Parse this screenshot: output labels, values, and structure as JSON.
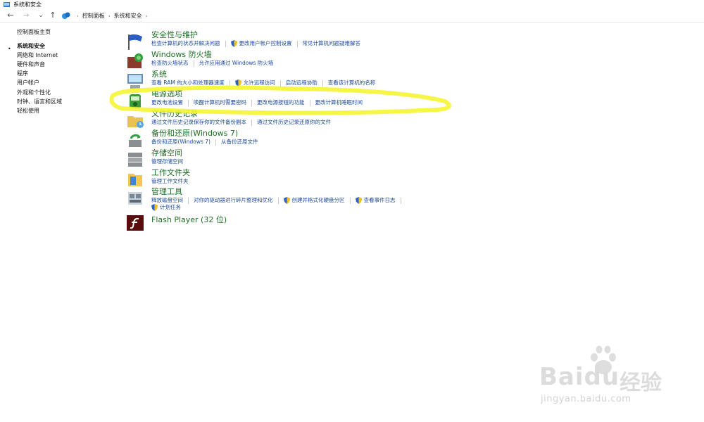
{
  "window": {
    "title": "系统和安全"
  },
  "nav": {
    "back_icon": "←",
    "forward_icon": "→",
    "dropdown_icon": "⌄",
    "up_icon": "↑",
    "breadcrumbs": [
      "控制面板",
      "系统和安全"
    ],
    "breadcrumb_sep": "›",
    "breadcrumb_dropdown": "›"
  },
  "sidebar": {
    "bullet": "•",
    "items": [
      {
        "label": "控制面板主页"
      },
      {
        "label": "系统和安全"
      },
      {
        "label": "网络和 Internet"
      },
      {
        "label": "硬件和声音"
      },
      {
        "label": "程序"
      },
      {
        "label": "用户帐户"
      },
      {
        "label": "外观和个性化"
      },
      {
        "label": "时钟、语言和区域"
      },
      {
        "label": "轻松使用"
      }
    ]
  },
  "categories": [
    {
      "icon": "flag-icon",
      "title": "安全性与维护",
      "links": [
        {
          "label": "检查计算机的状态并解决问题"
        },
        {
          "label": "更改用户帐户控制设置",
          "shield": true
        },
        {
          "label": "常见计算机问题疑难解答"
        }
      ]
    },
    {
      "icon": "firewall-icon",
      "title": "Windows 防火墙",
      "links": [
        {
          "label": "检查防火墙状态"
        },
        {
          "label": "允许应用通过 Windows 防火墙"
        }
      ]
    },
    {
      "icon": "computer-icon",
      "title": "系统",
      "links": [
        {
          "label": "查看 RAM 的大小和处理器速度"
        },
        {
          "label": "允许远程访问",
          "shield": true
        },
        {
          "label": "启动远程协助"
        },
        {
          "label": "查看该计算机的名称"
        }
      ]
    },
    {
      "icon": "power-icon",
      "title": "电源选项",
      "links": [
        {
          "label": "更改电池设置"
        },
        {
          "label": "唤醒计算机时需要密码"
        },
        {
          "label": "更改电源按钮的功能"
        },
        {
          "label": "更改计算机睡眠时间"
        }
      ]
    },
    {
      "icon": "file-history-icon",
      "title": "文件历史记录",
      "links": [
        {
          "label": "通过文件历史记录保存你的文件备份副本"
        },
        {
          "label": "通过文件历史记录还原你的文件"
        }
      ]
    },
    {
      "icon": "backup-icon",
      "title": "备份和还原(Windows 7)",
      "links": [
        {
          "label": "备份和还原(Windows 7)"
        },
        {
          "label": "从备份还原文件"
        }
      ]
    },
    {
      "icon": "storage-icon",
      "title": "存储空间",
      "links": [
        {
          "label": "管理存储空间"
        }
      ]
    },
    {
      "icon": "work-folders-icon",
      "title": "工作文件夹",
      "links": [
        {
          "label": "管理工作文件夹"
        }
      ]
    },
    {
      "icon": "admin-tools-icon",
      "title": "管理工具",
      "links": [
        {
          "label": "释放磁盘空间"
        },
        {
          "label": "对你的驱动器进行碎片整理和优化"
        },
        {
          "label": "创建并格式化硬盘分区",
          "shield": true
        },
        {
          "label": "查看事件日志",
          "shield": true
        }
      ],
      "links2": [
        {
          "label": "计划任务",
          "shield": true
        }
      ]
    },
    {
      "icon": "flash-icon",
      "title": "Flash Player (32 位)",
      "links": []
    }
  ],
  "watermark": {
    "brand": "Bai",
    "brand2": "du",
    "cn": "经验",
    "url": "jingyan.baidu.com"
  },
  "colors": {
    "title_green": "#1e6e24",
    "link_blue": "#1c4a9c",
    "highlight": "#f5f532"
  }
}
